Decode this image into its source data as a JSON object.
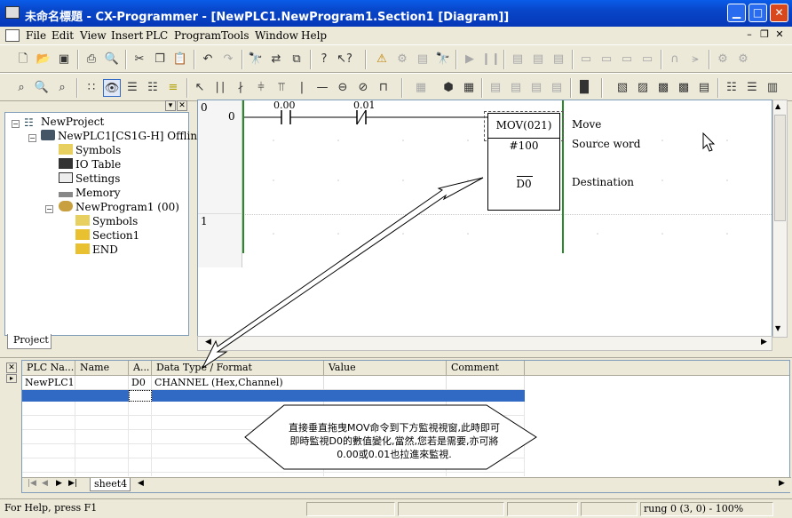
{
  "window": {
    "title": "未命名標題 - CX-Programmer - [NewPLC1.NewProgram1.Section1 [Diagram]]"
  },
  "menu": [
    "File",
    "Edit",
    "View",
    "Insert",
    "PLC",
    "Program",
    "Tools",
    "Window",
    "Help"
  ],
  "project_tree": {
    "root": "NewProject",
    "plc": "NewPLC1[CS1G-H] Offline",
    "plc_children": [
      "Symbols",
      "IO Table",
      "Settings",
      "Memory"
    ],
    "program": "NewProgram1 (00)",
    "program_children": [
      "Symbols",
      "Section1",
      "END"
    ],
    "tab_label": "Project"
  },
  "ladder": {
    "rung0_num": "0",
    "rung0_step": "0",
    "rung1_num": "1",
    "contact1_addr": "0.00",
    "contact2_addr": "0.01",
    "instruction": "MOV(021)",
    "operand1": "#100",
    "operand2": "D0",
    "comment1": "Move",
    "comment2": "Source word",
    "comment3": "Destination"
  },
  "watch": {
    "columns": [
      "PLC Na...",
      "Name",
      "A...",
      "Data Type / Format",
      "Value",
      "Comment"
    ],
    "rows": [
      {
        "plc": "NewPLC1",
        "name": "",
        "addr": "D0",
        "type": "CHANNEL (Hex,Channel)",
        "value": "",
        "comment": ""
      }
    ],
    "tab_label": "sheet4"
  },
  "callout": {
    "line1": "直接垂直拖曳MOV命令到下方監視視窗,此時即可",
    "line2": "即時監視D0的數值變化,當然,您若是需要,亦可將",
    "line3": "0.00或0.01也拉進來監視."
  },
  "status": {
    "help": "For Help, press F1",
    "position": "rung 0 (3, 0)  - 100%"
  }
}
